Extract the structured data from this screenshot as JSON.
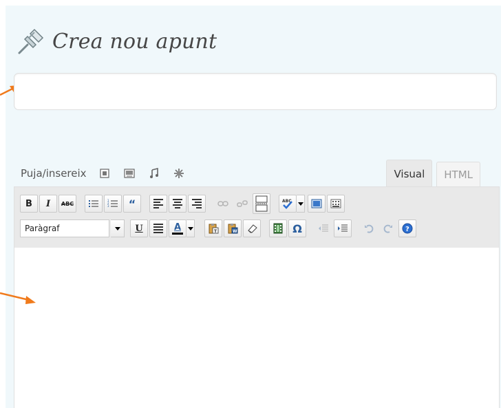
{
  "page": {
    "title": "Crea nou apunt",
    "icon": "pushpin-icon"
  },
  "title_field": {
    "value": "",
    "placeholder": ""
  },
  "media": {
    "label": "Puja/insereix",
    "icons": [
      "image-icon",
      "video-icon",
      "audio-icon",
      "media-icon"
    ]
  },
  "tabs": [
    {
      "label": "Visual",
      "active": true
    },
    {
      "label": "HTML",
      "active": false
    }
  ],
  "toolbar": {
    "bold_label": "B",
    "italic_label": "I",
    "strikethrough_label": "ABC",
    "format_select_value": "Paràgraf",
    "underline_label": "U",
    "text_color_label": "A",
    "omega_label": "Ω"
  },
  "colors": {
    "panel_bg": "#f0f8fb",
    "toolbar_bg": "#e9e9e9",
    "arrow": "#f07a1b"
  }
}
